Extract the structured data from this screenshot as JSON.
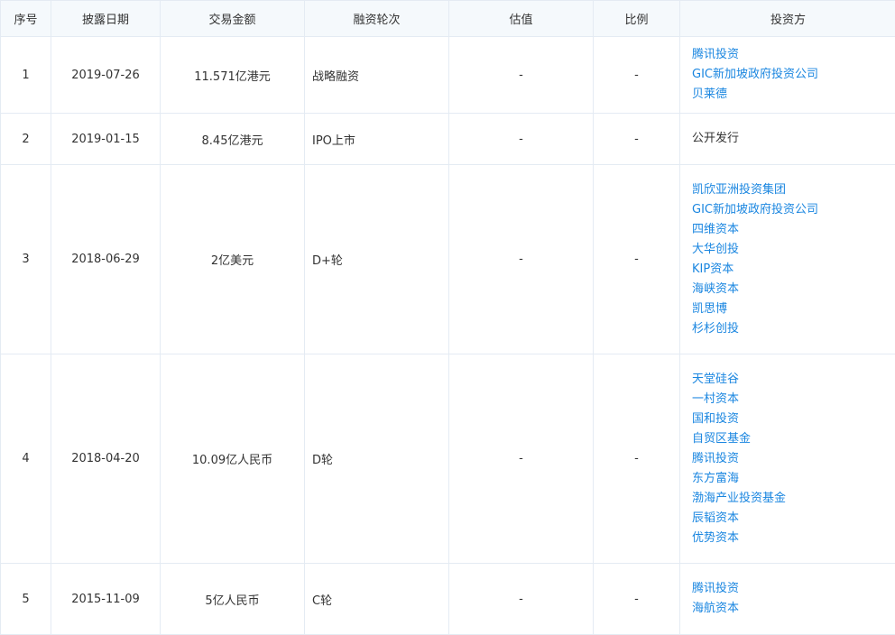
{
  "headers": {
    "index": "序号",
    "date": "披露日期",
    "amount": "交易金额",
    "round": "融资轮次",
    "valuation": "估值",
    "ratio": "比例",
    "investors": "投资方"
  },
  "rows": [
    {
      "index": "1",
      "date": "2019-07-26",
      "amount": "11.571亿港元",
      "round": "战略融资",
      "valuation": "-",
      "ratio": "-",
      "investors": [
        {
          "name": "腾讯投资",
          "link": true
        },
        {
          "name": "GIC新加坡政府投资公司",
          "link": true
        },
        {
          "name": "贝莱德",
          "link": true
        }
      ]
    },
    {
      "index": "2",
      "date": "2019-01-15",
      "amount": "8.45亿港元",
      "round": "IPO上市",
      "valuation": "-",
      "ratio": "-",
      "investors": [
        {
          "name": "公开发行",
          "link": false
        }
      ]
    },
    {
      "index": "3",
      "date": "2018-06-29",
      "amount": "2亿美元",
      "round": "D+轮",
      "valuation": "-",
      "ratio": "-",
      "investors": [
        {
          "name": "凯欣亚洲投资集团",
          "link": true
        },
        {
          "name": "GIC新加坡政府投资公司",
          "link": true
        },
        {
          "name": "四维资本",
          "link": true
        },
        {
          "name": "大华创投",
          "link": true
        },
        {
          "name": "KIP资本",
          "link": true
        },
        {
          "name": "海峡资本",
          "link": true
        },
        {
          "name": "凯思博",
          "link": true
        },
        {
          "name": "杉杉创投",
          "link": true
        }
      ]
    },
    {
      "index": "4",
      "date": "2018-04-20",
      "amount": "10.09亿人民币",
      "round": "D轮",
      "valuation": "-",
      "ratio": "-",
      "investors": [
        {
          "name": "天堂硅谷",
          "link": true
        },
        {
          "name": "一村资本",
          "link": true
        },
        {
          "name": "国和投资",
          "link": true
        },
        {
          "name": "自贸区基金",
          "link": true
        },
        {
          "name": "腾讯投资",
          "link": true
        },
        {
          "name": "东方富海",
          "link": true
        },
        {
          "name": "渤海产业投资基金",
          "link": true
        },
        {
          "name": "辰韬资本",
          "link": true
        },
        {
          "name": "优势资本",
          "link": true
        }
      ]
    },
    {
      "index": "5",
      "date": "2015-11-09",
      "amount": "5亿人民币",
      "round": "C轮",
      "valuation": "-",
      "ratio": "-",
      "investors": [
        {
          "name": "腾讯投资",
          "link": true
        },
        {
          "name": "海航资本",
          "link": true
        }
      ]
    }
  ],
  "colors": {
    "header_bg": "#f5f9fc",
    "border": "#e4ebf3",
    "link": "#1a86e0",
    "text": "#333333"
  }
}
